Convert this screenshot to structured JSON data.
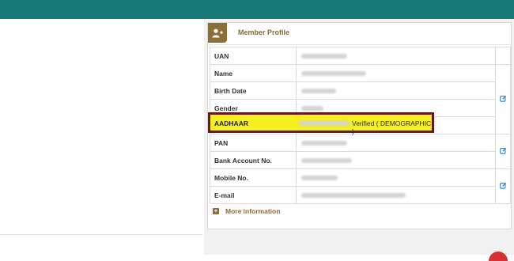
{
  "header": {
    "title": "Member Profile",
    "icon": "add-user-icon"
  },
  "fields": [
    {
      "label": "UAN"
    },
    {
      "label": "Name"
    },
    {
      "label": "Birth Date"
    },
    {
      "label": "Gender"
    },
    {
      "label": "AADHAAR",
      "status": "Verified ( DEMOGRAPHIC )"
    },
    {
      "label": "PAN"
    },
    {
      "label": "Bank Account No."
    },
    {
      "label": "Mobile No."
    },
    {
      "label": "E-mail"
    }
  ],
  "more_info": {
    "label": "More information",
    "icon": "plus-square-icon"
  },
  "colors": {
    "topbar": "#177a77",
    "brand_brown": "#8a6f36",
    "highlight": "#f5ef1f",
    "highlight_border": "#6b1515",
    "edit_icon": "#2e7fd1"
  }
}
